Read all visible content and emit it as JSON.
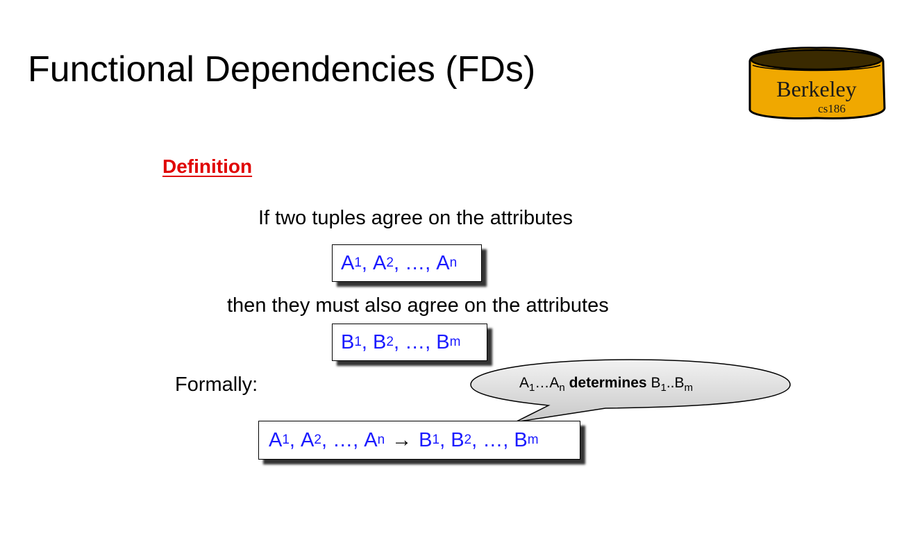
{
  "title": "Functional Dependencies (FDs)",
  "logo": {
    "text": "Berkeley",
    "subtext": "cs186",
    "fill": "#f0a800"
  },
  "definition_heading": "Definition",
  "line1": "If two tuples agree on the attributes",
  "line2": "then they must also agree on the attributes",
  "formally": "Formally:",
  "a_box": {
    "v1": "A",
    "s1": "1",
    "v2": "A",
    "s2": "2",
    "ellipsis": "…",
    "v3": "A",
    "s3": "n"
  },
  "b_box": {
    "v1": "B",
    "s1": "1",
    "v2": "B",
    "s2": "2",
    "ellipsis": "…",
    "v3": "B",
    "s3": "m"
  },
  "formula": {
    "l1": "A",
    "ls1": "1",
    "l2": "A",
    "ls2": "2",
    "lell": "…",
    "l3": "A",
    "ls3": "n",
    "arrow": "→",
    "r1": "B",
    "rs1": "1",
    "r2": "B",
    "rs2": "2",
    "rell": "…",
    "r3": "B",
    "rs3": "m"
  },
  "bubble": {
    "a": "A",
    "a_sub1": "1",
    "mid1": "…",
    "a2": "A",
    "a_subn": "n",
    "verb": "determines",
    "b": "B",
    "b_sub1": "1",
    "mid2": "..",
    "b2": "B",
    "b_subm": "m"
  },
  "colors": {
    "blue_text": "#1a1aff",
    "heading_red": "#e00000"
  }
}
